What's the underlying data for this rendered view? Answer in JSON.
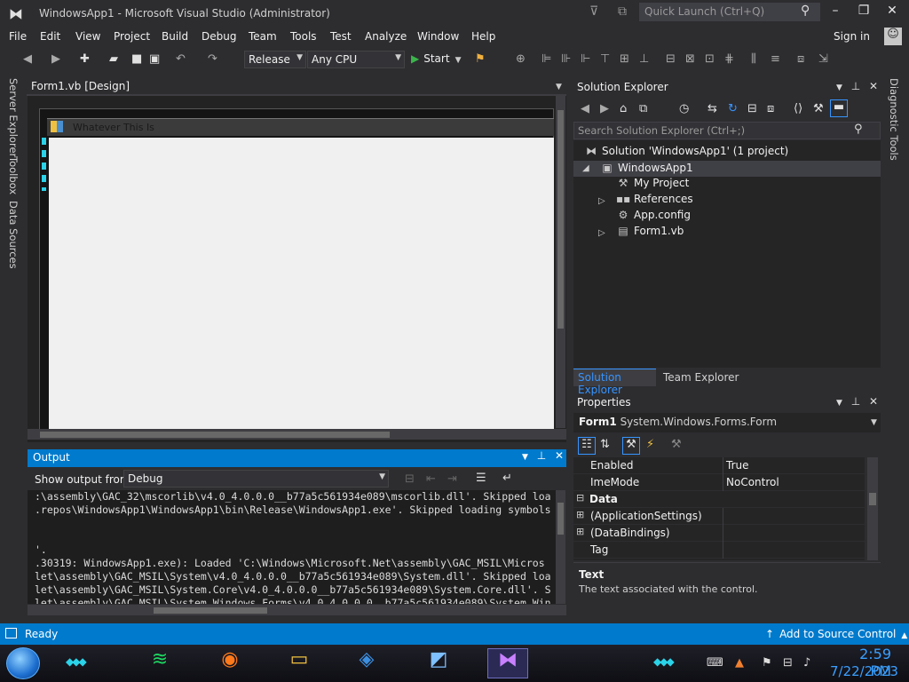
{
  "window": {
    "title": "WindowsApp1 - Microsoft Visual Studio  (Administrator)",
    "quick_launch_placeholder": "Quick Launch (Ctrl+Q)",
    "controls": [
      "–",
      "❐",
      "✕"
    ]
  },
  "menu": {
    "items": [
      "File",
      "Edit",
      "View",
      "Project",
      "Build",
      "Debug",
      "Team",
      "Tools",
      "Test",
      "Analyze",
      "Window",
      "Help"
    ],
    "sign_in": "Sign in"
  },
  "toolbar": {
    "configuration": "Release",
    "platform": "Any CPU",
    "start_label": "Start"
  },
  "left_rail": [
    "Server Explorer",
    "Toolbox",
    "Data Sources"
  ],
  "right_rail": "Diagnostic Tools",
  "document": {
    "tab_label": "Form1.vb [Design]",
    "form_title": "Whatever This Is"
  },
  "output": {
    "title": "Output",
    "show_from_label": "Show output from:",
    "source": "Debug",
    "lines": [
      ":\\assembly\\GAC_32\\mscorlib\\v4.0_4.0.0.0__b77a5c561934e089\\mscorlib.dll'. Skipped loa",
      ".repos\\WindowsApp1\\WindowsApp1\\bin\\Release\\WindowsApp1.exe'. Skipped loading symbols",
      "",
      "'.",
      ".30319: WindowsApp1.exe): Loaded 'C:\\Windows\\Microsoft.Net\\assembly\\GAC_MSIL\\Micros",
      "let\\assembly\\GAC_MSIL\\System\\v4.0_4.0.0.0__b77a5c561934e089\\System.dll'. Skipped loa",
      "let\\assembly\\GAC_MSIL\\System.Core\\v4.0_4.0.0.0__b77a5c561934e089\\System.Core.dll'. S",
      "let\\assembly\\GAC_MSIL\\System.Windows.Forms\\v4.0_4.0.0.0__b77a5c561934e089\\System.Win"
    ]
  },
  "solution_explorer": {
    "title": "Solution Explorer",
    "search_placeholder": "Search Solution Explorer (Ctrl+;)",
    "solution": "Solution 'WindowsApp1' (1 project)",
    "project": "WindowsApp1",
    "items": [
      "My Project",
      "References",
      "App.config",
      "Form1.vb"
    ],
    "tabs": [
      "Solution Explorer",
      "Team Explorer"
    ]
  },
  "properties": {
    "title": "Properties",
    "object_name": "Form1",
    "object_type": "System.Windows.Forms.Form",
    "rows": [
      {
        "name": "Enabled",
        "value": "True"
      },
      {
        "name": "ImeMode",
        "value": "NoControl"
      }
    ],
    "category": "Data",
    "data_rows": [
      {
        "name": "(ApplicationSettings)",
        "value": ""
      },
      {
        "name": "(DataBindings)",
        "value": ""
      },
      {
        "name": "Tag",
        "value": ""
      }
    ],
    "desc_title": "Text",
    "desc_text": "The text associated with the control."
  },
  "status": {
    "text": "Ready",
    "source_control": "Add to Source Control"
  },
  "taskbar": {
    "time": "2:59 PM",
    "date": "7/22/2023"
  }
}
